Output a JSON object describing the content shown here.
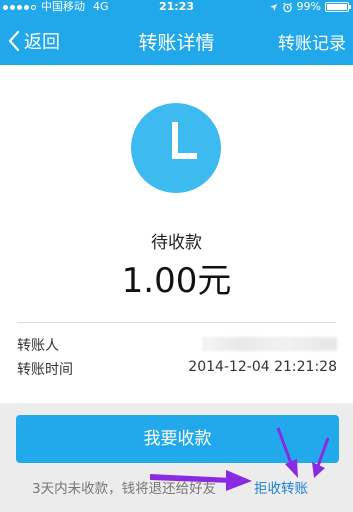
{
  "status_bar": {
    "carrier": "中国移动",
    "network": "4G",
    "time": "21:23",
    "battery_percent": "99%",
    "battery_level": 0.99
  },
  "nav": {
    "back_label": "返回",
    "title": "转账详情",
    "right_label": "转账记录"
  },
  "transfer": {
    "status": "待收款",
    "amount": "1.00元",
    "payee_label": "转账人",
    "time_label": "转账时间",
    "time_value": "2014-12-04 21:21:28"
  },
  "actions": {
    "receive_button": "我要收款",
    "note": "3天内未收款，钱将退还给好友",
    "reject_link": "拒收转账"
  },
  "colors": {
    "header": "#20a8ea",
    "button": "#22a9ec",
    "clock": "#3dbaf0",
    "link": "#1d82d6",
    "annotation_arrow": "#8a2be2"
  },
  "icons": {
    "back": "chevron-left-icon",
    "clock": "clock-icon",
    "alarm": "alarm-icon",
    "location": "location-arrow-icon",
    "wifi": "wifi-icon"
  }
}
